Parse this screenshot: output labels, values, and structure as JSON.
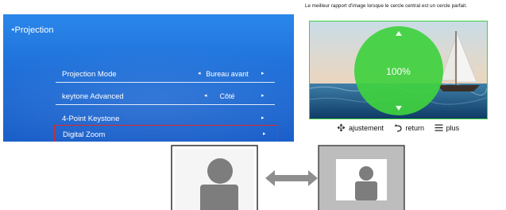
{
  "menu": {
    "title": "Projection",
    "rows": [
      {
        "label": "Projection Mode",
        "value": "Bureau avant"
      },
      {
        "label": "keytone Advanced",
        "value": "Côté"
      },
      {
        "label": "4-Point Keystone",
        "value": ""
      },
      {
        "label": "Digital Zoom",
        "value": ""
      }
    ]
  },
  "caption": "Le meilleur rapport  d'image  lorsque le cercle central est un cercle parfait.",
  "preview": {
    "zoom_value": "100%"
  },
  "legend": {
    "adjust": "ajustement",
    "return": "return",
    "more": "plus"
  },
  "colors": {
    "menu_bg": "#1f6fd8",
    "highlight_border": "#e02828",
    "zoom_circle": "#3fd13f",
    "arrow_grey": "#8e8e8e"
  }
}
